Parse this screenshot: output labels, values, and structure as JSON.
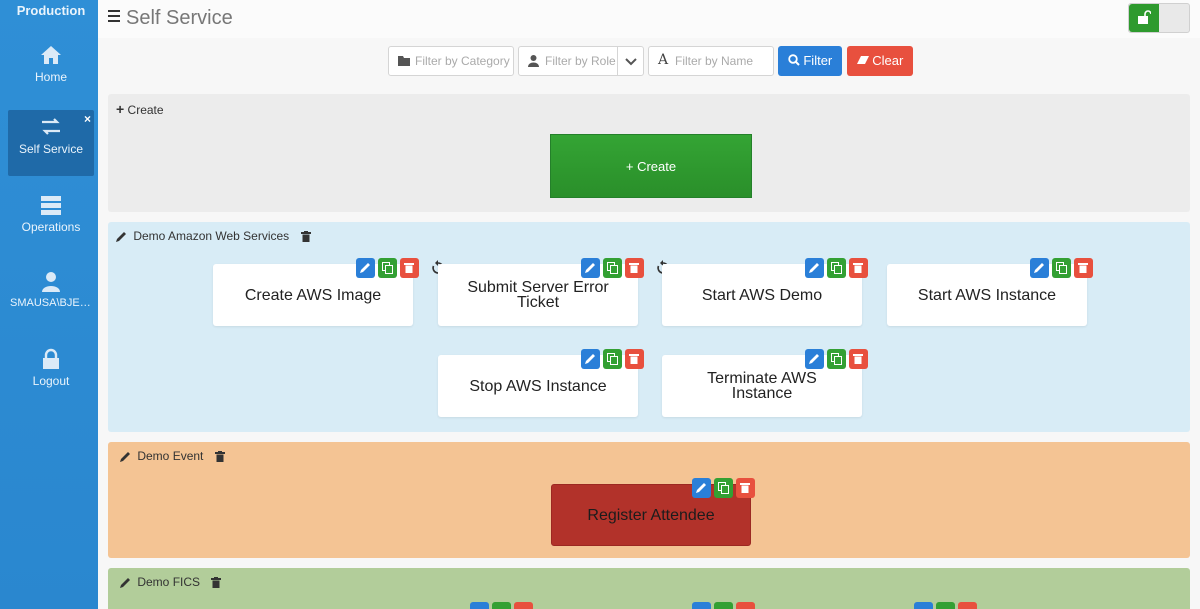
{
  "sidebar": {
    "environment": "Production",
    "items": [
      {
        "label": "Home",
        "icon": "home-icon"
      },
      {
        "label": "Self Service",
        "icon": "transfer-icon",
        "active": true
      },
      {
        "label": "Operations",
        "icon": "server-icon"
      },
      {
        "label": "SMAUSA\\BJERN...",
        "icon": "user-icon"
      },
      {
        "label": "Logout",
        "icon": "lock-icon"
      }
    ]
  },
  "header": {
    "title": "Self Service"
  },
  "filters": {
    "category_placeholder": "Filter by Category",
    "role_placeholder": "Filter by Role",
    "name_placeholder": "Filter by Name",
    "filter_label": "Filter",
    "clear_label": "Clear"
  },
  "sections": {
    "create": {
      "title": "Create",
      "button_label": "+ Create"
    },
    "aws": {
      "title": "Demo Amazon Web Services",
      "tiles": [
        "Create AWS Image",
        "Submit Server Error Ticket",
        "Start AWS Demo",
        "Start AWS Instance",
        "Stop AWS Instance",
        "Terminate AWS Instance"
      ]
    },
    "event": {
      "title": "Demo Event",
      "tiles": [
        "Register Attendee"
      ]
    },
    "fics": {
      "title": "Demo FICS"
    }
  },
  "colors": {
    "sidebar": "#2f8fd6",
    "primary": "#2a7fd8",
    "success": "#33a033",
    "danger": "#e8503e",
    "aws_section": "#d8ecf6",
    "event_section": "#f4c494",
    "fics_section": "#b2cd9a"
  }
}
